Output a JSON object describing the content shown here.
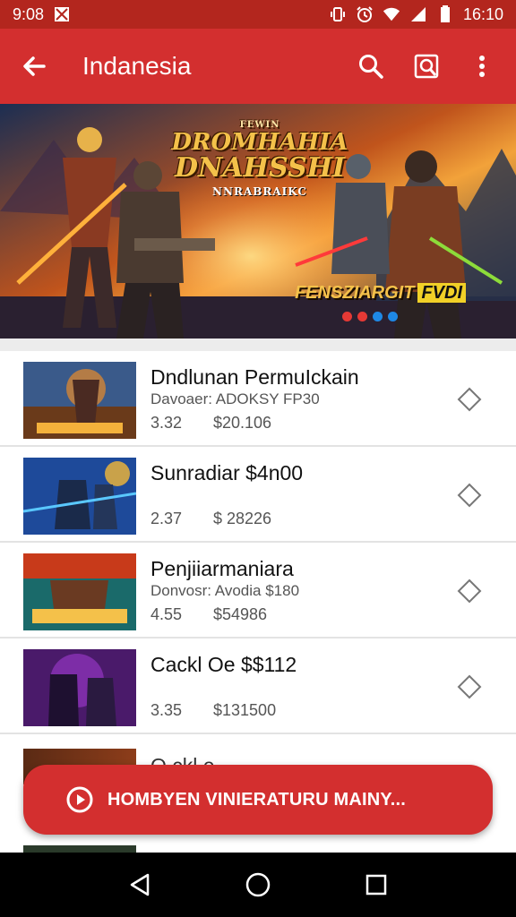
{
  "status_bar": {
    "time_left": "9:08",
    "time_right": "16:10",
    "icons_left": [
      "image-icon"
    ],
    "icons_right": [
      "vibrate-icon",
      "alarm-icon",
      "wifi-icon",
      "signal-icon",
      "battery-icon"
    ]
  },
  "app_bar": {
    "title": "Indanesia",
    "back_icon": "arrow-back-icon",
    "actions": [
      "search-icon",
      "image-search-icon",
      "more-vert-icon"
    ]
  },
  "banner": {
    "small_text": "FEWIN",
    "title_line1": "DROMHAHIA",
    "title_line2": "DNAHSSHI",
    "subtitle": "NNRABRAIKC",
    "caption": "FENSZIARGIT",
    "caption_highlight": "FVDI",
    "dot_colors": [
      "#e53935",
      "#e53935",
      "#1e88e5",
      "#1e88e5"
    ]
  },
  "list": [
    {
      "title": "Dndlunan PermuIсkain",
      "subtitle": "Davoaer: ADOKSY FP30",
      "rating": "3.32",
      "price": "$20.106"
    },
    {
      "title": "Sunradiar $4n00",
      "subtitle": "",
      "rating": "2.37",
      "price": "$ 28226"
    },
    {
      "title": "Penjiiarmaniara",
      "subtitle": "Donvosr: Avodia $180",
      "rating": "4.55",
      "price": "$54986"
    },
    {
      "title": "Cackl Oe $$112",
      "subtitle": "",
      "rating": "3.35",
      "price": "$131500"
    }
  ],
  "partial_item": {
    "title": "Q ckl  e"
  },
  "snackbar": {
    "label": "HOMBYEN VINIERATURU MAINY...",
    "icon": "play-circle-icon"
  },
  "nav_bar": {
    "buttons": [
      "back-triangle-icon",
      "home-circle-icon",
      "recents-square-icon"
    ]
  },
  "colors": {
    "primary": "#d32f2f",
    "status_bar": "#b3261e",
    "divider": "#e3e3e3"
  }
}
